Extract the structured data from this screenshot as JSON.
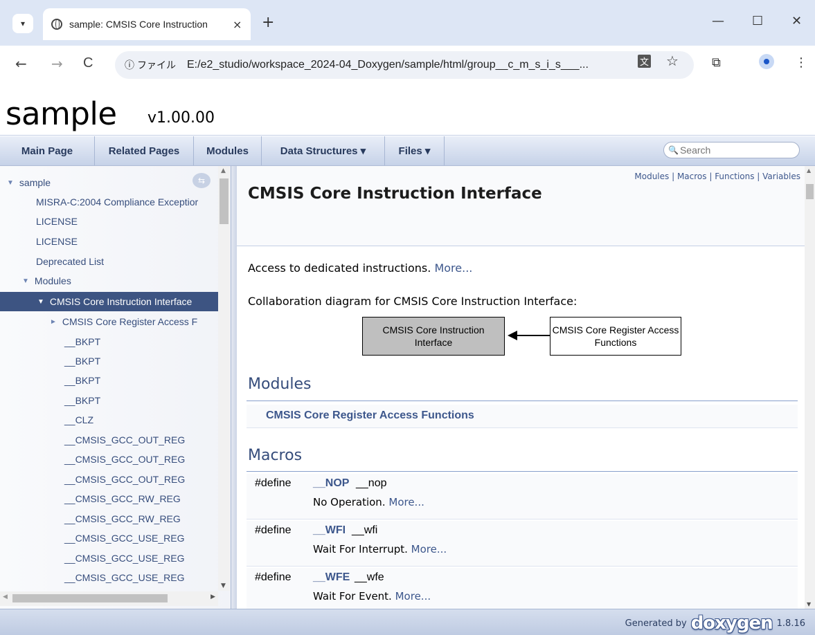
{
  "browser": {
    "tab_title": "sample: CMSIS Core Instruction",
    "tab_close": "×",
    "new_tab": "+",
    "scheme_label": "ファイル",
    "url": "E:/e2_studio/workspace_2024-04_Doxygen/sample/html/group__c_m_s_i_s___...",
    "back_icon": "←",
    "forward_icon": "→",
    "reload_icon": "C",
    "info_icon": "ⓘ",
    "minimize_icon": "—",
    "maximize_icon": "☐",
    "close_icon": "✕",
    "star_icon": "☆",
    "translate_icon": "文",
    "extensions_icon": "⧉",
    "menu_icon": "⋮"
  },
  "project": {
    "name": "sample",
    "number": "v1.00.00"
  },
  "navbar": {
    "items": [
      "Main Page",
      "Related Pages",
      "Modules",
      "Data Structures ▾",
      "Files ▾"
    ],
    "search_placeholder": "Search"
  },
  "tree": {
    "root": "sample",
    "items": [
      {
        "label": "MISRA-C:2004 Compliance Exceptior"
      },
      {
        "label": "LICENSE"
      },
      {
        "label": "LICENSE"
      },
      {
        "label": "Deprecated List"
      },
      {
        "label": "Modules"
      },
      {
        "label": "CMSIS Core Instruction Interface"
      },
      {
        "label": "CMSIS Core Register Access F"
      },
      {
        "label": "__BKPT"
      },
      {
        "label": "__BKPT"
      },
      {
        "label": "__BKPT"
      },
      {
        "label": "__BKPT"
      },
      {
        "label": "__CLZ"
      },
      {
        "label": "__CMSIS_GCC_OUT_REG"
      },
      {
        "label": "__CMSIS_GCC_OUT_REG"
      },
      {
        "label": "__CMSIS_GCC_OUT_REG"
      },
      {
        "label": "__CMSIS_GCC_RW_REG"
      },
      {
        "label": "__CMSIS_GCC_RW_REG"
      },
      {
        "label": "__CMSIS_GCC_USE_REG"
      },
      {
        "label": "__CMSIS_GCC_USE_REG"
      },
      {
        "label": "__CMSIS_GCC_USE_REG"
      }
    ]
  },
  "content": {
    "summary_links": "Modules | Macros | Functions | Variables",
    "title": "CMSIS Core Instruction Interface",
    "brief": "Access to dedicated instructions.",
    "more": "More...",
    "collab_caption": "Collaboration diagram for CMSIS Core Instruction Interface:",
    "diagram": {
      "box1": "CMSIS Core Instruction Interface",
      "box2": "CMSIS Core Register Access Functions"
    },
    "modules_heading": "Modules",
    "modules": [
      "CMSIS Core Register Access Functions"
    ],
    "macros_heading": "Macros",
    "macros": [
      {
        "kw": "#define",
        "name": "__NOP",
        "value": "__nop",
        "desc": "No Operation.",
        "more": "More..."
      },
      {
        "kw": "#define",
        "name": "__WFI",
        "value": "__wfi",
        "desc": "Wait For Interrupt.",
        "more": "More..."
      },
      {
        "kw": "#define",
        "name": "__WFE",
        "value": "__wfe",
        "desc": "Wait For Event.",
        "more": "More..."
      }
    ]
  },
  "footer": {
    "generated_by": "Generated by",
    "logo": "doxygen",
    "version": "1.8.16"
  }
}
